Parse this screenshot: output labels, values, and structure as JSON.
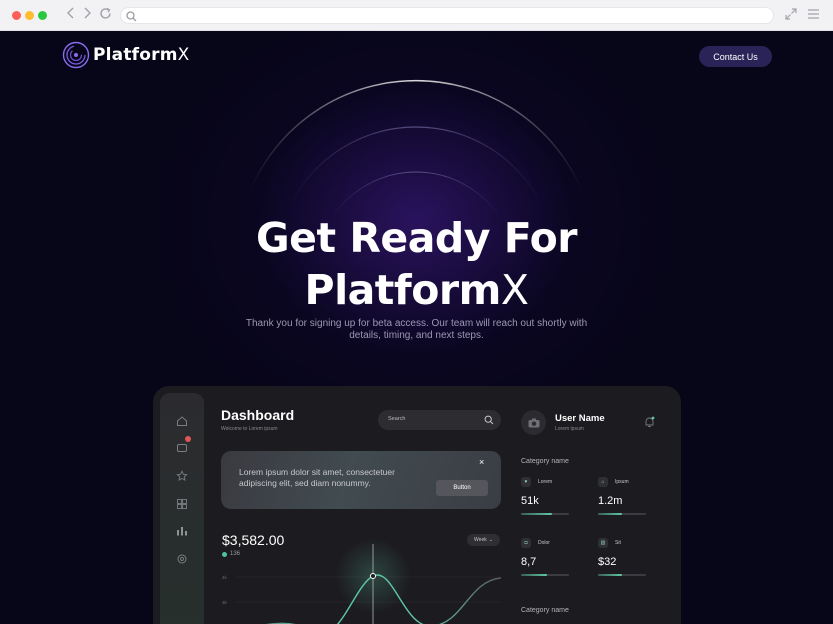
{
  "browser": {
    "url": "",
    "icons": [
      "back-icon",
      "forward-icon",
      "reload-icon",
      "search-icon",
      "expand-icon",
      "menu-icon"
    ]
  },
  "header": {
    "brand_main": "Platform",
    "brand_x": "X",
    "contact_label": "Contact Us"
  },
  "hero": {
    "title_line1": "Get Ready For",
    "title_line2_main": "Platform",
    "title_line2_x": "X",
    "subtitle": "Thank you for signing up for beta access. Our team will reach out shortly with details, timing, and next steps."
  },
  "dashboard": {
    "title": "Dashboard",
    "subtitle": "Welcome to Lorem ipsum",
    "search_placeholder": "Search",
    "card": {
      "text": "Lorem ipsum dolor sit amet, consectetuer adipiscing elit, sed diam nonummy.",
      "close": "×",
      "button_label": "Button"
    },
    "amount": "$3,582.00",
    "change": "136",
    "period": "Week",
    "chart_axis": [
      "4k",
      "3k"
    ],
    "user": {
      "name": "User Name",
      "role": "Lorem ipsum"
    },
    "category_label_1": "Category name",
    "category_label_2": "Category name",
    "stats": [
      {
        "label": "Lorem",
        "value": "51k",
        "progress": 0.65,
        "icon": "heart-icon"
      },
      {
        "label": "Ipsum",
        "value": "1.2m",
        "progress": 0.5,
        "icon": "home-icon"
      },
      {
        "label": "Dolor",
        "value": "8,7",
        "progress": 0.55,
        "icon": "camera-icon"
      },
      {
        "label": "Sit",
        "value": "$32",
        "progress": 0.5,
        "icon": "chart-icon"
      }
    ]
  },
  "colors": {
    "page_bg": "#070518",
    "accent_purple": "#2a2358",
    "accent_green": "#5fc7a3",
    "dashboard_bg": "#1c1b1f"
  }
}
